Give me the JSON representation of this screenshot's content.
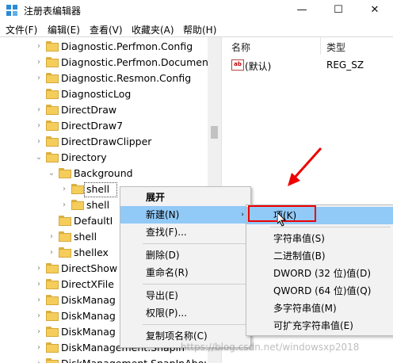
{
  "window": {
    "title": "注册表编辑器",
    "minimize": "—",
    "maximize": "☐",
    "close": "✕"
  },
  "menu": [
    "文件(F)",
    "编辑(E)",
    "查看(V)",
    "收藏夹(A)",
    "帮助(H)"
  ],
  "tree": [
    {
      "label": "Diagnostic.Perfmon.Config",
      "expander": "›",
      "level": 0
    },
    {
      "label": "Diagnostic.Perfmon.Document",
      "expander": "›",
      "level": 0
    },
    {
      "label": "Diagnostic.Resmon.Config",
      "expander": "›",
      "level": 0
    },
    {
      "label": "DiagnosticLog",
      "expander": "",
      "level": 0
    },
    {
      "label": "DirectDraw",
      "expander": "›",
      "level": 0
    },
    {
      "label": "DirectDraw7",
      "expander": "›",
      "level": 0
    },
    {
      "label": "DirectDrawClipper",
      "expander": "›",
      "level": 0
    },
    {
      "label": "Directory",
      "expander": "⌄",
      "level": 0
    },
    {
      "label": "Background",
      "expander": "⌄",
      "level": 1
    },
    {
      "label": "shell",
      "expander": "›",
      "level": 2
    },
    {
      "label": "shell",
      "expander": "›",
      "level": 2
    },
    {
      "label": "DefaultI",
      "expander": "",
      "level": 1
    },
    {
      "label": "shell",
      "expander": "›",
      "level": 1
    },
    {
      "label": "shellex",
      "expander": "›",
      "level": 1
    },
    {
      "label": "DirectShow",
      "expander": "›",
      "level": 0
    },
    {
      "label": "DirectXFile",
      "expander": "›",
      "level": 0
    },
    {
      "label": "DiskManag",
      "expander": "›",
      "level": 0
    },
    {
      "label": "DiskManag",
      "expander": "›",
      "level": 0
    },
    {
      "label": "DiskManag",
      "expander": "›",
      "level": 0
    },
    {
      "label": "DiskManagement.Snapin",
      "expander": "›",
      "level": 0
    },
    {
      "label": "DiskManagement.SnapInAbou",
      "expander": "›",
      "level": 0
    }
  ],
  "list": {
    "col_name": "名称",
    "col_type": "类型",
    "rows": [
      {
        "icon": "ab",
        "name": "(默认)",
        "type": "REG_SZ"
      }
    ]
  },
  "context_menu": {
    "items": [
      {
        "label": "展开",
        "bold": true
      },
      {
        "label": "新建(N)",
        "submenu": "›",
        "highlight": true
      },
      {
        "label": "查找(F)..."
      },
      {
        "sep": true
      },
      {
        "label": "删除(D)"
      },
      {
        "label": "重命名(R)"
      },
      {
        "sep": true
      },
      {
        "label": "导出(E)"
      },
      {
        "label": "权限(P)..."
      },
      {
        "sep": true
      },
      {
        "label": "复制项名称(C)"
      }
    ]
  },
  "submenu": {
    "items": [
      {
        "label": "项(K)",
        "highlight": true
      },
      {
        "sep": true
      },
      {
        "label": "字符串值(S)"
      },
      {
        "label": "二进制值(B)"
      },
      {
        "label": "DWORD (32 位)值(D)"
      },
      {
        "label": "QWORD (64 位)值(Q)"
      },
      {
        "label": "多字符串值(M)"
      },
      {
        "label": "可扩充字符串值(E)"
      }
    ]
  },
  "watermark": "https://blog.csdn.net/windowsxp2018",
  "colors": {
    "highlight": "#91c9f7",
    "annotation": "#e00000",
    "folder": "#f4cd5a"
  }
}
